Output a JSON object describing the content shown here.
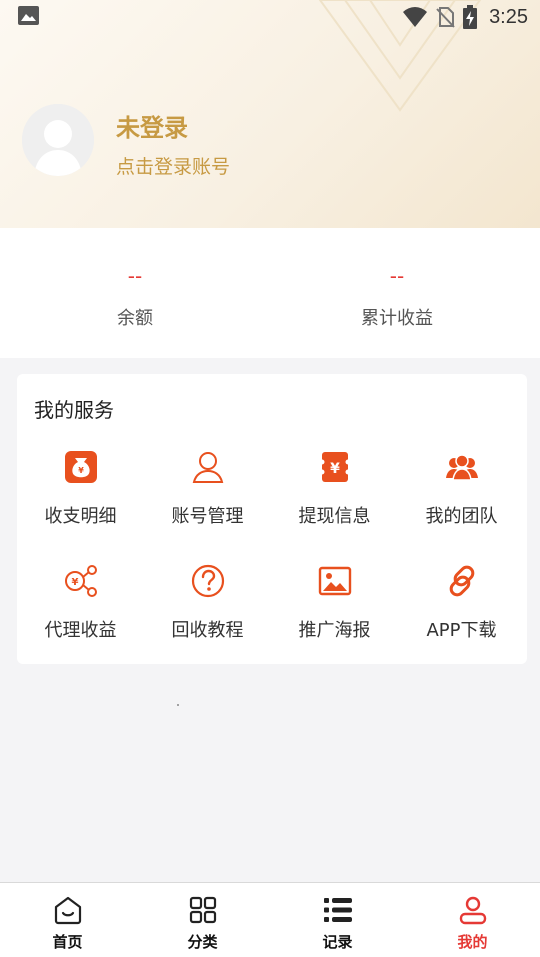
{
  "status_bar": {
    "time": "3:25"
  },
  "profile": {
    "title": "未登录",
    "subtitle": "点击登录账号",
    "avatar_icon": "default-user-avatar-icon"
  },
  "stats": [
    {
      "value": "--",
      "label": "余额"
    },
    {
      "value": "--",
      "label": "累计收益"
    }
  ],
  "services": {
    "title": "我的服务",
    "items": [
      {
        "label": "收支明细",
        "icon": "money-bag-icon"
      },
      {
        "label": "账号管理",
        "icon": "user-outline-icon"
      },
      {
        "label": "提现信息",
        "icon": "yen-bill-icon"
      },
      {
        "label": "我的团队",
        "icon": "team-icon"
      },
      {
        "label": "代理收益",
        "icon": "share-yen-icon"
      },
      {
        "label": "回收教程",
        "icon": "question-circle-icon"
      },
      {
        "label": "推广海报",
        "icon": "image-poster-icon"
      },
      {
        "label": "APP下载",
        "icon": "link-chain-icon"
      }
    ]
  },
  "tabbar": {
    "active_index": 3,
    "items": [
      {
        "label": "首页",
        "icon": "home-icon"
      },
      {
        "label": "分类",
        "icon": "grid-category-icon"
      },
      {
        "label": "记录",
        "icon": "list-icon"
      },
      {
        "label": "我的",
        "icon": "profile-icon"
      }
    ]
  },
  "colors": {
    "accent": "#e8501e",
    "gold_text": "#c79a43",
    "active_tab": "#e53935",
    "value_red": "#e53935"
  }
}
